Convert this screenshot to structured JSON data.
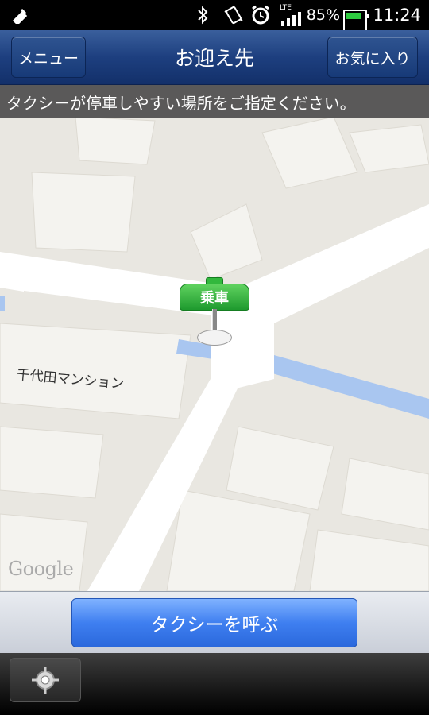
{
  "status_bar": {
    "time": "11:24",
    "battery_percent": "85%",
    "network": "LTE",
    "icons": [
      "usb-icon",
      "bluetooth-icon",
      "vibrate-icon",
      "alarm-icon",
      "signal-icon",
      "battery-icon"
    ]
  },
  "header": {
    "title": "お迎え先",
    "menu_label": "メニュー",
    "favorites_label": "お気に入り"
  },
  "instruction": "タクシーが停車しやすい場所をご指定ください。",
  "map": {
    "place_label": "千代田マンション",
    "pin_label": "乗車",
    "attribution": "Google"
  },
  "actions": {
    "call_label": "タクシーを呼ぶ"
  },
  "toolbar": {
    "icons": [
      "current-location-icon"
    ]
  },
  "colors": {
    "header_blue": "#1d3f7f",
    "call_button_blue": "#3f7ff0",
    "pin_green": "#1e9a2e",
    "water_blue": "#a9c6f0"
  }
}
